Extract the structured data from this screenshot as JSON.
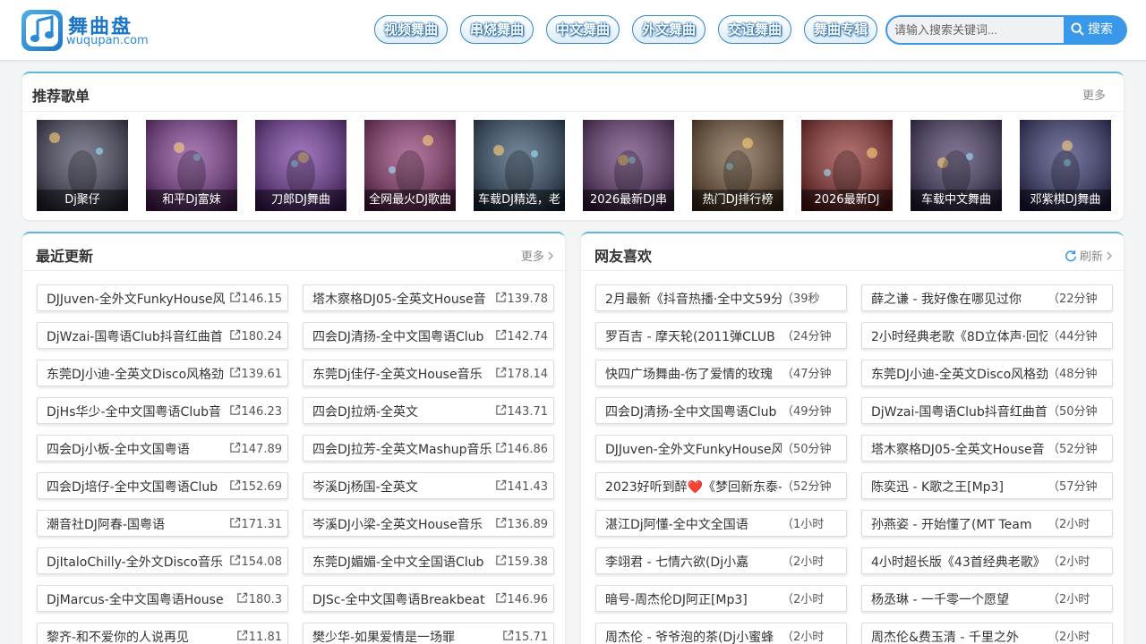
{
  "site": {
    "name": "舞曲盘",
    "domain": "wuqupan.com"
  },
  "nav": [
    "视频舞曲",
    "串烧舞曲",
    "中文舞曲",
    "外文舞曲",
    "交谊舞曲",
    "舞曲专辑"
  ],
  "search": {
    "placeholder": "请输入搜索关键词...",
    "button": "搜索"
  },
  "recommended": {
    "title": "推荐歌单",
    "more": "更多",
    "items": [
      {
        "label": "Dj聚仔",
        "theme": "#3a3a55"
      },
      {
        "label": "和平Dj富妹",
        "theme": "#7a2f8f"
      },
      {
        "label": "刀郎DJ舞曲",
        "theme": "#6b2a9a"
      },
      {
        "label": "全网最火DJ歌曲",
        "theme": "#8a2a6a"
      },
      {
        "label": "车载DJ精选，老",
        "theme": "#24405e"
      },
      {
        "label": "2026最新DJ串",
        "theme": "#5a2a6a"
      },
      {
        "label": "热门DJ排行榜",
        "theme": "#6a4a2a"
      },
      {
        "label": "2026最新DJ",
        "theme": "#8a2020"
      },
      {
        "label": "车载中文舞曲",
        "theme": "#3a2a5a"
      },
      {
        "label": "邓紫棋DJ舞曲",
        "theme": "#2a2a6a"
      }
    ]
  },
  "recent": {
    "title": "最近更新",
    "more": "更多",
    "items": [
      {
        "title": "DJJuven-全外文FunkyHouse风",
        "size": "146.15"
      },
      {
        "title": "塔木察格DJ05-全英文House音",
        "size": "139.78"
      },
      {
        "title": "DjWzai-国粤语Club抖音红曲首",
        "size": "180.24"
      },
      {
        "title": "四会DJ清扬-全中文国粤语Club",
        "size": "142.74"
      },
      {
        "title": "东莞DJ小迪-全英文Disco风格劲",
        "size": "139.61"
      },
      {
        "title": "东莞Dj佳仔-全英文House音乐",
        "size": "178.14"
      },
      {
        "title": "DjHs华少-全中文国粤语Club音",
        "size": "146.23"
      },
      {
        "title": "四会DJ拉炳-全英文",
        "size": "143.71"
      },
      {
        "title": "四会Dj小板-全中文国粤语",
        "size": "147.89"
      },
      {
        "title": "四会DJ拉芳-全英文Mashup音乐",
        "size": "146.86"
      },
      {
        "title": "四会Dj培仔-全中文国粤语Club",
        "size": "152.69"
      },
      {
        "title": "岑溪Dj杨国-全英文",
        "size": "141.43"
      },
      {
        "title": "潮音社DJ阿春-国粤语",
        "size": "171.31"
      },
      {
        "title": "岑溪DJ小梁-全英文House音乐",
        "size": "136.89"
      },
      {
        "title": "DjItaloChilly-全外文Disco音乐",
        "size": "154.08"
      },
      {
        "title": "东莞DJ媚媚-全中文全国语Club",
        "size": "159.38"
      },
      {
        "title": "DjMarcus-全中文国粤语House",
        "size": "180.3"
      },
      {
        "title": "DJSc-全中文国粤语Breakbeat",
        "size": "146.96"
      },
      {
        "title": "黎齐-和不爱你的人说再见",
        "size": "11.81"
      },
      {
        "title": "樊少华-如果爱情是一场罪",
        "size": "15.71"
      }
    ]
  },
  "favorites": {
    "title": "网友喜欢",
    "more": "刷新",
    "items": [
      {
        "title": "2月最新《抖音热播·全中文59分",
        "time": "（39秒"
      },
      {
        "title": "薛之谦 - 我好像在哪见过你",
        "time": "（22分钟"
      },
      {
        "title": "罗百吉 - 摩天轮(2011弹CLUB",
        "time": "（24分钟"
      },
      {
        "title": "2小时经典老歌《8D立体声·回忆",
        "time": "（44分钟"
      },
      {
        "title": "快四广场舞曲-伤了爱情的玫瑰",
        "time": "（47分钟"
      },
      {
        "title": "东莞DJ小迪-全英文Disco风格劲",
        "time": "（48分钟"
      },
      {
        "title": "四会DJ清扬-全中文国粤语Club",
        "time": "（49分钟"
      },
      {
        "title": "DjWzai-国粤语Club抖音红曲首",
        "time": "（50分钟"
      },
      {
        "title": "DJJuven-全外文FunkyHouse风",
        "time": "（50分钟"
      },
      {
        "title": "塔木察格DJ05-全英文House音",
        "time": "（52分钟"
      },
      {
        "title": "2023好听到醉❤️《梦回新东泰-",
        "time": "（52分钟"
      },
      {
        "title": "陈奕迅 - K歌之王[Mp3]",
        "time": "（57分钟"
      },
      {
        "title": "湛江Dj阿懂-全中文全国语",
        "time": "（1小时"
      },
      {
        "title": "孙燕姿 - 开始懂了(MT Team",
        "time": "（2小时"
      },
      {
        "title": "李翊君 - 七情六欲(Dj小嘉",
        "time": "（2小时"
      },
      {
        "title": "4小时超长版《43首经典老歌》",
        "time": "（2小时"
      },
      {
        "title": "暗号-周杰伦DJ阿正[Mp3]",
        "time": "（2小时"
      },
      {
        "title": "杨丞琳 - 一千零一个愿望",
        "time": "（2小时"
      },
      {
        "title": "周杰伦 - 爷爷泡的茶(Dj小蜜蜂",
        "time": "（2小时"
      },
      {
        "title": "周杰伦&费玉清 - 千里之外",
        "time": "（2小时"
      }
    ]
  }
}
